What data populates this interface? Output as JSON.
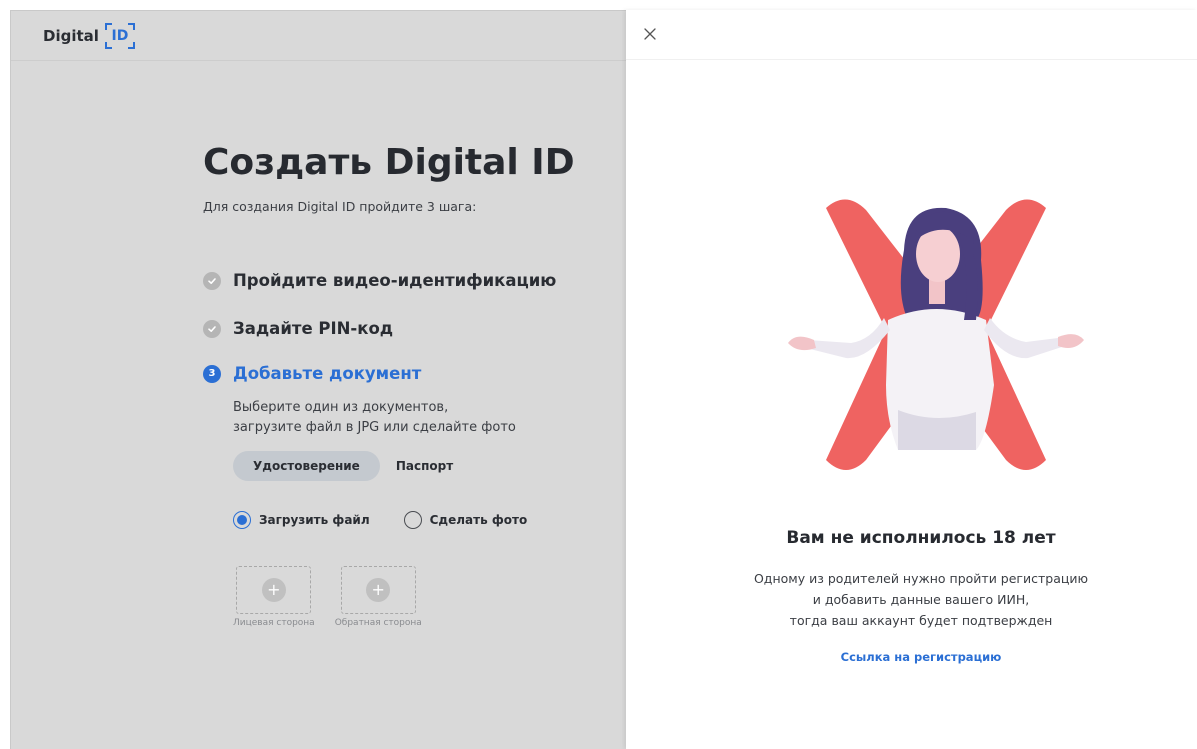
{
  "header": {
    "logo_text": "Digital",
    "logo_id": "ID"
  },
  "main": {
    "title": "Создать Digital ID",
    "subtitle": "Для создания Digital ID пройдите 3 шага:",
    "steps": [
      {
        "label": "Пройдите видео-идентификацию",
        "status": "done"
      },
      {
        "label": "Задайте PIN-код",
        "status": "done"
      },
      {
        "number": "3",
        "label": "Добавьте документ",
        "status": "active"
      }
    ],
    "step_desc": [
      "Выберите один из документов,",
      "загрузите файл в JPG или сделайте фото"
    ],
    "doc_tabs": [
      {
        "label": "Удостоверение",
        "active": true
      },
      {
        "label": "Паспорт",
        "active": false
      }
    ],
    "radios": [
      {
        "label": "Загрузить файл",
        "checked": true
      },
      {
        "label": "Сделать фото",
        "checked": false
      }
    ],
    "uploads": [
      {
        "label": "Лицевая сторона"
      },
      {
        "label": "Обратная сторона"
      }
    ]
  },
  "modal": {
    "title": "Вам не исполнилось 18 лет",
    "body": [
      "Одному из родителей нужно пройти регистрацию",
      "и добавить данные вашего ИИН,",
      "тогда ваш аккаунт будет подтвержден"
    ],
    "link": "Ссылка на регистрацию"
  },
  "colors": {
    "accent": "#2b6fd4",
    "illustration_red": "#ef6361",
    "hair": "#4a3f7e"
  }
}
